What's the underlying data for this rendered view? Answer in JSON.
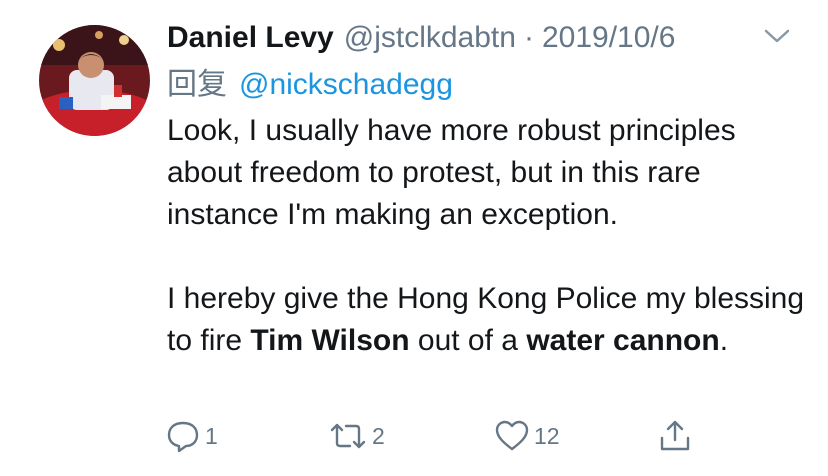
{
  "tweet": {
    "author_name": "Daniel Levy",
    "author_handle": "@jstclkdabtn",
    "separator": "·",
    "date": "2019/10/6",
    "reply_prefix": "回复",
    "reply_to": "@nickschadegg",
    "body": {
      "p1": "Look, I usually have more robust principles about freedom to protest, but in this rare instance I'm making an exception.",
      "p2_a": "I hereby give the Hong Kong Police my blessing to fire ",
      "p2_b": "Tim Wilson",
      "p2_c": " out of a ",
      "p2_d": "water cannon",
      "p2_e": "."
    }
  },
  "actions": {
    "reply_count": "1",
    "retweet_count": "2",
    "like_count": "12",
    "icons": [
      "reply-icon",
      "retweet-icon",
      "like-icon",
      "share-icon"
    ]
  },
  "colors": {
    "text": "#14171a",
    "secondary": "#657786",
    "link": "#1b95e0"
  }
}
